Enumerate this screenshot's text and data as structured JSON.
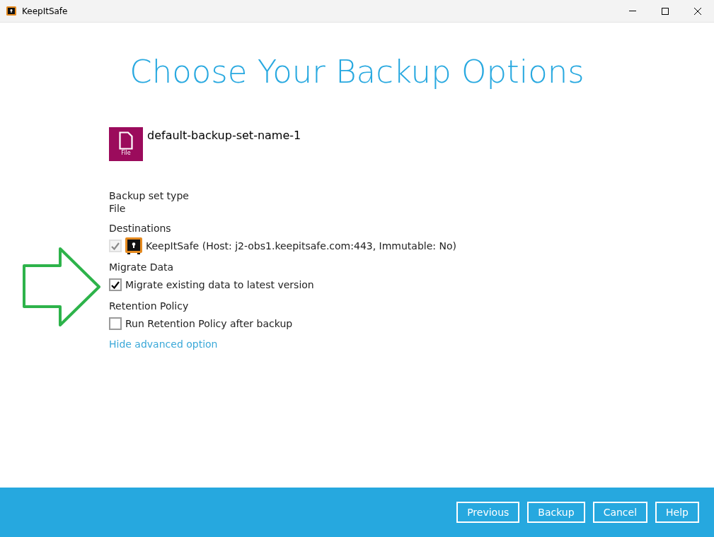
{
  "window": {
    "title": "KeepItSafe"
  },
  "heading": "Choose Your Backup Options",
  "backup_set": {
    "name": "default-backup-set-name-1",
    "icon_label": "File"
  },
  "sections": [
    {
      "label": "Backup set type",
      "kind": "text",
      "value": "File"
    },
    {
      "label": "Destinations",
      "kind": "checkbox",
      "text": "KeepItSafe (Host: j2-obs1.keepitsafe.com:443, Immutable: No)",
      "checked": true,
      "disabled": true,
      "has_logo": true
    },
    {
      "label": "Migrate Data",
      "kind": "checkbox",
      "text": "Migrate existing data to latest version",
      "checked": true,
      "disabled": false,
      "has_logo": false
    },
    {
      "label": "Retention Policy",
      "kind": "checkbox",
      "text": "Run Retention Policy after backup",
      "checked": false,
      "disabled": false,
      "has_logo": false
    }
  ],
  "advanced_link": "Hide advanced option",
  "buttons": [
    "Previous",
    "Backup",
    "Cancel",
    "Help"
  ]
}
